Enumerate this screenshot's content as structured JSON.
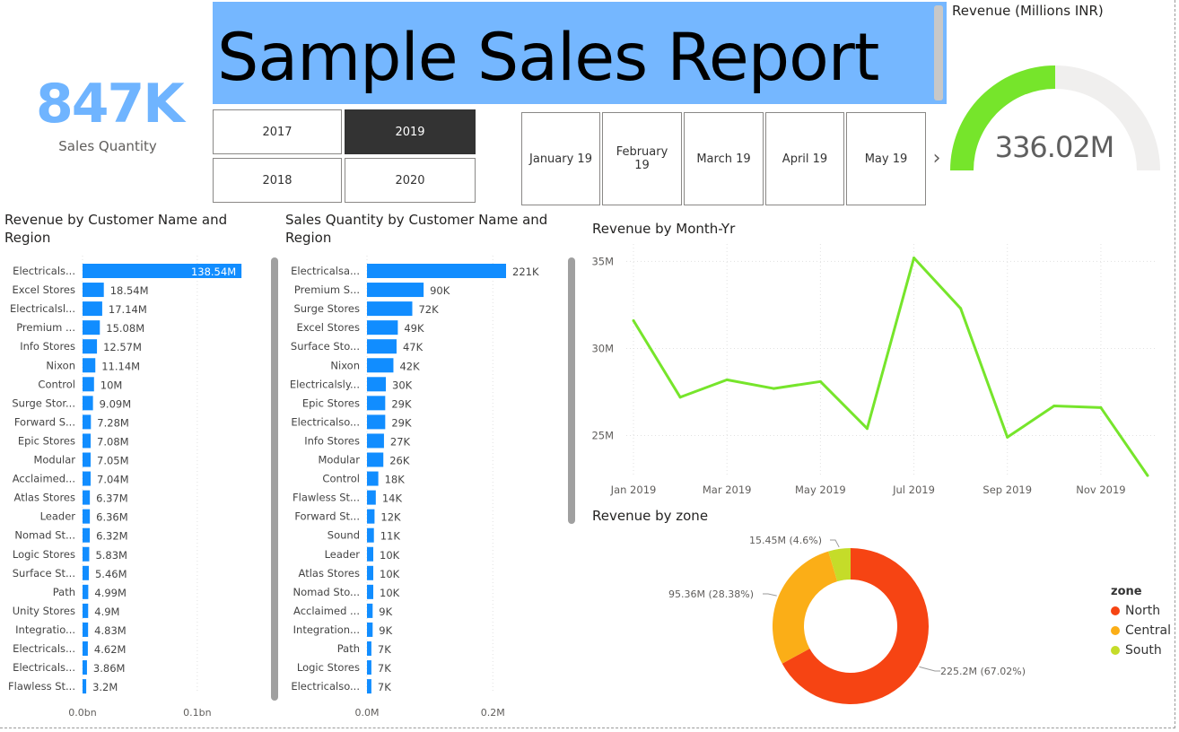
{
  "kpi": {
    "value": "847K",
    "label": "Sales Quantity"
  },
  "title": "Sample Sales Report",
  "year_slicer": {
    "options": [
      "2017",
      "2019",
      "2018",
      "2020"
    ],
    "selected": "2019"
  },
  "month_slicer": {
    "options": [
      "January 19",
      "February 19",
      "March 19",
      "April 19",
      "May 19"
    ]
  },
  "gauge": {
    "title": "Revenue (Millions INR)",
    "value_label": "336.02M",
    "fill_fraction": 0.5,
    "fill_color": "#76e52b",
    "track_color": "#f0efee"
  },
  "charts": {
    "revenue_by_customer": {
      "title": "Revenue by Customer Name and Region",
      "bar_color": "#118dff"
    },
    "qty_by_customer": {
      "title": "Sales Quantity by Customer Name and Region",
      "bar_color": "#118dff"
    },
    "revenue_by_month": {
      "title": "Revenue by Month-Yr",
      "line_color": "#76e52b"
    },
    "revenue_by_zone": {
      "title": "Revenue by zone",
      "legend_title": "zone"
    }
  },
  "chart_data": [
    {
      "type": "bar",
      "orientation": "horizontal",
      "categories": [
        "Electricals...",
        "Excel Stores",
        "Electricalsl...",
        "Premium ...",
        "Info Stores",
        "Nixon",
        "Control",
        "Surge Stor...",
        "Forward S...",
        "Epic Stores",
        "Modular",
        "Acclaimed...",
        "Atlas Stores",
        "Leader",
        "Nomad St...",
        "Logic Stores",
        "Surface St...",
        "Path",
        "Unity Stores",
        "Integratio...",
        "Electricals...",
        "Electricals...",
        "Flawless St..."
      ],
      "values": [
        138.54,
        18.54,
        17.14,
        15.08,
        12.57,
        11.14,
        10,
        9.09,
        7.28,
        7.08,
        7.05,
        7.04,
        6.37,
        6.36,
        6.32,
        5.83,
        5.46,
        4.99,
        4.9,
        4.83,
        4.62,
        3.86,
        3.2
      ],
      "value_labels": [
        "138.54M",
        "18.54M",
        "17.14M",
        "15.08M",
        "12.57M",
        "11.14M",
        "10M",
        "9.09M",
        "7.28M",
        "7.08M",
        "7.05M",
        "7.04M",
        "6.37M",
        "6.36M",
        "6.32M",
        "5.83M",
        "5.46M",
        "4.99M",
        "4.9M",
        "4.83M",
        "4.62M",
        "3.86M",
        "3.2M"
      ],
      "unit": "M",
      "x_ticks": [
        "0.0bn",
        "0.1bn"
      ],
      "x_tick_values": [
        0,
        100
      ],
      "xlim": [
        0,
        140
      ],
      "grid": true
    },
    {
      "type": "bar",
      "orientation": "horizontal",
      "categories": [
        "Electricalsa...",
        "Premium S...",
        "Surge Stores",
        "Excel Stores",
        "Surface Sto...",
        "Nixon",
        "Electricalsly...",
        "Epic Stores",
        "Electricalso...",
        "Info Stores",
        "Modular",
        "Control",
        "Flawless St...",
        "Forward St...",
        "Sound",
        "Leader",
        "Atlas Stores",
        "Nomad Sto...",
        "Acclaimed ...",
        "Integration...",
        "Path",
        "Logic Stores",
        "Electricalso..."
      ],
      "values": [
        221,
        90,
        72,
        49,
        47,
        42,
        30,
        29,
        29,
        27,
        26,
        18,
        14,
        12,
        11,
        10,
        10,
        10,
        9,
        9,
        7,
        7,
        7
      ],
      "value_labels": [
        "221K",
        "90K",
        "72K",
        "49K",
        "47K",
        "42K",
        "30K",
        "29K",
        "29K",
        "27K",
        "26K",
        "18K",
        "14K",
        "12K",
        "11K",
        "10K",
        "10K",
        "10K",
        "9K",
        "9K",
        "7K",
        "7K",
        "7K"
      ],
      "unit": "K",
      "x_ticks": [
        "0.0M",
        "0.2M"
      ],
      "x_tick_values": [
        0,
        200
      ],
      "xlim": [
        0,
        221
      ],
      "grid": true
    },
    {
      "type": "line",
      "x": [
        "2019-01",
        "2019-02",
        "2019-03",
        "2019-04",
        "2019-05",
        "2019-06",
        "2019-07",
        "2019-08",
        "2019-09",
        "2019-10",
        "2019-11",
        "2019-12"
      ],
      "series": [
        {
          "values": [
            31.6,
            27.2,
            28.2,
            27.7,
            28.1,
            25.4,
            35.2,
            32.3,
            24.9,
            26.7,
            26.6,
            22.7
          ]
        }
      ],
      "x_tick_labels": [
        "Jan 2019",
        "Mar 2019",
        "May 2019",
        "Jul 2019",
        "Sep 2019",
        "Nov 2019"
      ],
      "y_tick_labels": [
        "25M",
        "30M",
        "35M"
      ],
      "y_ticks": [
        25,
        30,
        35
      ],
      "ylim": [
        22.5,
        36
      ],
      "ylabel": "",
      "xlabel": "",
      "grid": true
    },
    {
      "type": "pie",
      "donut": true,
      "categories": [
        "North",
        "Central",
        "South"
      ],
      "values": [
        225.2,
        95.36,
        15.45
      ],
      "percent": [
        67.02,
        28.38,
        4.6
      ],
      "labels": [
        "225.2M (67.02%)",
        "95.36M (28.38%)",
        "15.45M (4.6%)"
      ],
      "colors": [
        "#f64413",
        "#fbae17",
        "#c5dc29"
      ],
      "legend": "right",
      "legend_title": "zone"
    }
  ]
}
